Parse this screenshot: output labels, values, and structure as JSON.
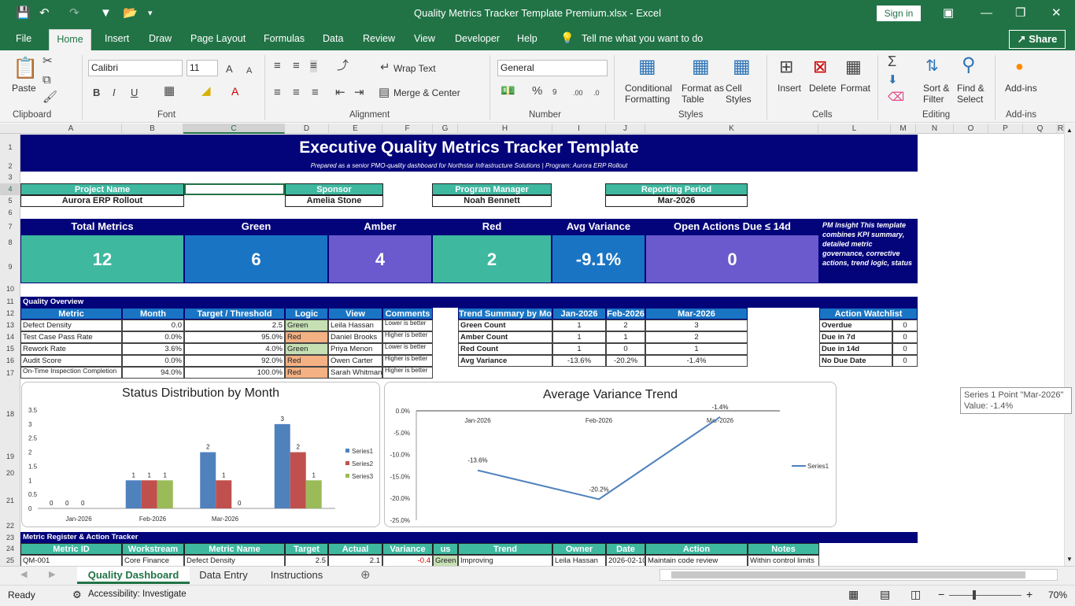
{
  "window": {
    "title": "Quality Metrics Tracker Template Premium.xlsx  -  Excel",
    "sign_in": "Sign in"
  },
  "ribbon_tabs": [
    "File",
    "Home",
    "Insert",
    "Draw",
    "Page Layout",
    "Formulas",
    "Data",
    "Review",
    "View",
    "Developer",
    "Help"
  ],
  "tell_me": "Tell me what you want to do",
  "share": "Share",
  "ribbon": {
    "paste": "Paste",
    "font_name": "Calibri",
    "font_size": "11",
    "wrap_text": "Wrap Text",
    "merge_center": "Merge & Center",
    "number_format": "General",
    "conditional_formatting": [
      "Conditional",
      "Formatting"
    ],
    "format_as_table": [
      "Format as",
      "Table"
    ],
    "cell_styles": [
      "Cell",
      "Styles"
    ],
    "insert": "Insert",
    "delete": "Delete",
    "format": "Format",
    "sort_filter": [
      "Sort &",
      "Filter"
    ],
    "find_select": [
      "Find &",
      "Select"
    ],
    "addins": "Add-ins",
    "groups": [
      "Clipboard",
      "Font",
      "Alignment",
      "Number",
      "Styles",
      "Cells",
      "Editing",
      "Add-ins"
    ]
  },
  "columns": [
    "A",
    "B",
    "C",
    "D",
    "E",
    "F",
    "G",
    "H",
    "I",
    "J",
    "K",
    "L",
    "M",
    "N",
    "O",
    "P",
    "Q",
    "R"
  ],
  "rows": [
    "1",
    "2",
    "3",
    "4",
    "5",
    "6",
    "7",
    "8",
    "9",
    "10",
    "11",
    "12",
    "13",
    "14",
    "15",
    "16",
    "17",
    "18",
    "19",
    "20",
    "21",
    "22",
    "23",
    "24",
    "25"
  ],
  "sheet": {
    "title": "Executive Quality Metrics Tracker Template",
    "subtitle": "Prepared as a senior PMO-quality dashboard for Northstar Infrastructure Solutions | Program: Aurora ERP Rollout",
    "info": [
      {
        "label": "Project Name",
        "value": "Aurora ERP Rollout"
      },
      {
        "label": "Sponsor",
        "value": "Amelia Stone"
      },
      {
        "label": "Program Manager",
        "value": "Noah Bennett"
      },
      {
        "label": "Reporting Period",
        "value": "Mar-2026"
      }
    ],
    "kpis": [
      {
        "label": "Total Metrics",
        "value": "12",
        "color": "#3fb8a0"
      },
      {
        "label": "Green",
        "value": "6",
        "color": "#1a74c4"
      },
      {
        "label": "Amber",
        "value": "4",
        "color": "#6a5acd"
      },
      {
        "label": "Red",
        "value": "2",
        "color": "#3fb8a0"
      },
      {
        "label": "Avg Variance",
        "value": "-9.1%",
        "color": "#1a74c4"
      },
      {
        "label": "Open Actions Due ≤ 14d",
        "value": "0",
        "color": "#6a5acd"
      }
    ],
    "insight": "PM Insight This template combines KPI summary, detailed metric governance, corrective actions, trend logic, status",
    "quality_overview_label": "Quality Overview",
    "overview_headers": [
      "Metric",
      "Month",
      "Target / Threshold",
      "Logic",
      "View",
      "Comments"
    ],
    "overview_rows": [
      [
        "Defect Density",
        "0.0",
        "2.5",
        "Green",
        "Leila Hassan",
        "Lower is better"
      ],
      [
        "Test Case Pass Rate",
        "0.0%",
        "95.0%",
        "Red",
        "Daniel Brooks",
        "Higher is better"
      ],
      [
        "Rework Rate",
        "3.6%",
        "4.0%",
        "Green",
        "Priya Menon",
        "Lower is better"
      ],
      [
        "Audit Score",
        "0.0%",
        "92.0%",
        "Red",
        "Owen Carter",
        "Higher is better"
      ],
      [
        "On-Time Inspection Completion",
        "94.0%",
        "100.0%",
        "Red",
        "Sarah Whitman",
        "Higher is better"
      ]
    ],
    "trend_headers": [
      "Trend Summary by Month",
      "Jan-2026",
      "Feb-2026",
      "Mar-2026"
    ],
    "trend_rows": [
      [
        "Green Count",
        "1",
        "2",
        "3"
      ],
      [
        "Amber Count",
        "1",
        "1",
        "2"
      ],
      [
        "Red Count",
        "1",
        "0",
        "1"
      ],
      [
        "Avg Variance",
        "-13.6%",
        "-20.2%",
        "-1.4%"
      ]
    ],
    "watch_header": "Action Watchlist",
    "watch_rows": [
      [
        "Overdue",
        "0"
      ],
      [
        "Due in 7d",
        "0"
      ],
      [
        "Due in 14d",
        "0"
      ],
      [
        "No Due Date",
        "0"
      ]
    ],
    "register_label": "Metric Register & Action Tracker",
    "register_headers": [
      "Metric ID",
      "Workstream",
      "Metric Name",
      "Target",
      "Actual",
      "Variance",
      "us",
      "Trend",
      "Owner",
      "Date",
      "Action",
      "Notes"
    ],
    "register_row": [
      "QM-001",
      "Core Finance",
      "Defect Density",
      "2.5",
      "2.1",
      "-0.4",
      "Green",
      "Improving",
      "Leila Hassan",
      "2026-02-10",
      "Maintain code review",
      "Within control limits"
    ]
  },
  "chart_data": [
    {
      "type": "bar",
      "title": "Status Distribution by Month",
      "categories": [
        "Jan-2026",
        "Feb-2026",
        "Mar-2026"
      ],
      "ylim": [
        0,
        3.5
      ],
      "yticks": [
        "3.5",
        "3",
        "2.5",
        "2",
        "1.5",
        "1",
        "0.5",
        "0"
      ],
      "series": [
        {
          "name": "Series1",
          "values": [
            0,
            1,
            2,
            3
          ],
          "color": "#4f81bd"
        },
        {
          "name": "Series2",
          "values": [
            0,
            1,
            1,
            2
          ],
          "color": "#c0504d"
        },
        {
          "name": "Series3",
          "values": [
            0,
            1,
            0,
            1
          ],
          "color": "#9bbb59"
        }
      ],
      "groups_note": "",
      "legend": "right"
    },
    {
      "type": "line",
      "title": "Average Variance Trend",
      "categories": [
        "Jan-2026",
        "Feb-2026",
        "Mar-2026"
      ],
      "ylim": [
        -25,
        0
      ],
      "yticks": [
        "0.0%",
        "-5.0%",
        "-10.0%",
        "-15.0%",
        "-20.0%",
        "-25.0%"
      ],
      "series": [
        {
          "name": "Series1",
          "values": [
            -13.6,
            -20.2,
            -1.4
          ],
          "labels": [
            "-13.6%",
            "-20.2%",
            "-1.4%"
          ],
          "color": "#4f81bd"
        }
      ],
      "legend": "right"
    }
  ],
  "tooltip": {
    "line1": "Series 1 Point \"Mar-2026\"",
    "line2": "Value: -1.4%"
  },
  "sheet_tabs": [
    "Quality Dashboard",
    "Data Entry",
    "Instructions"
  ],
  "status": {
    "ready": "Ready",
    "accessibility": "Accessibility: Investigate",
    "zoom": "70%"
  }
}
